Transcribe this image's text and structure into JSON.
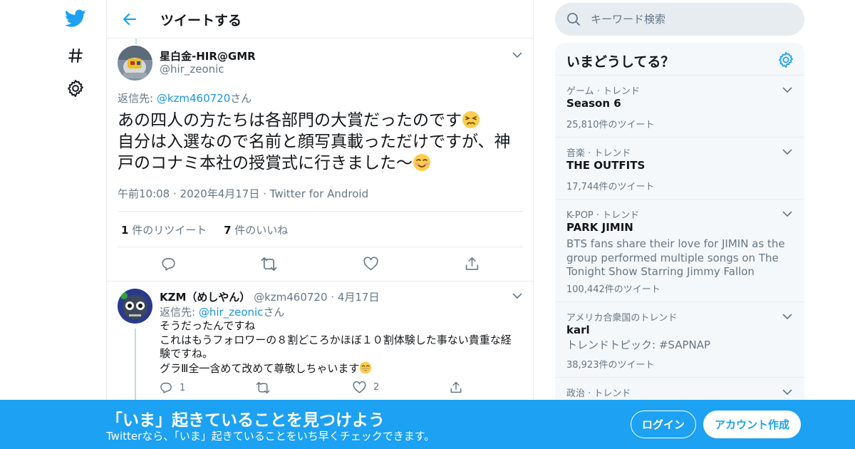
{
  "nav": {
    "logo_icon": "twitter-bird-icon",
    "explore_icon": "hashtag-icon",
    "settings_icon": "gear-icon",
    "accent": "#1da1f2"
  },
  "header": {
    "back_icon": "back-arrow-icon",
    "title": "ツイートする"
  },
  "tweet": {
    "author_name": "星白金-HIR@GMR",
    "author_handle": "@hir_zeonic",
    "reply_to_prefix": "返信先: ",
    "reply_to_handle": "@kzm460720",
    "reply_to_suffix": "さん",
    "text_line1": "あの四人の方たちは各部門の大賞だったのです",
    "text_line2": "自分は入選なので名前と顔写真載っただけですが、神戸のコナミ本社の授賞式に行きました～",
    "emoji1": "persevering-face-emoji",
    "emoji2": "smiling-face-emoji",
    "time": "午前10:08",
    "date": "2020年4月17日",
    "source": "Twitter for Android",
    "retweets_count": "1",
    "retweets_label": "件のリツイート",
    "likes_count": "7",
    "likes_label": "件のいいね",
    "actions": [
      "reply-icon",
      "retweet-icon",
      "like-icon",
      "share-icon"
    ]
  },
  "reply": {
    "author_name": "KZM（めしやん）",
    "author_handle": "@kzm460720",
    "date": "4月17日",
    "reply_to_prefix": "返信先: ",
    "reply_to_handle": "@hir_zeonic",
    "reply_to_suffix": "さん",
    "line1": "そうだったんですね",
    "line2": "これはもうフォロワーの８割どころかほぼ１０割体験した事ない貴重な経験ですね。",
    "line3": "グラⅢ全一含めて改めて尊敬しちゃいます",
    "emoji": "grinning-face-emoji",
    "reply_count": "1",
    "retweet_count": "",
    "like_count": "2"
  },
  "search": {
    "placeholder": "キーワード検索"
  },
  "trends": {
    "title": "いまどうしてる？",
    "items": [
      {
        "category": "ゲーム · トレンド",
        "name": "Season 6",
        "description": "",
        "count": "25,810件のツイート"
      },
      {
        "category": "音楽 · トレンド",
        "name": "THE OUTFITS",
        "description": "",
        "count": "17,744件のツイート"
      },
      {
        "category": "K-POP · トレンド",
        "name": "PARK JIMIN",
        "description": "BTS fans share their love for JIMIN as the group performed multiple songs on The Tonight Show Starring Jimmy Fallon",
        "count": "100,442件のツイート"
      },
      {
        "category": "アメリカ合衆国のトレンド",
        "name": "karl",
        "description": "トレンドトピック: #SAPNAP",
        "count": "38,923件のツイート"
      },
      {
        "category": "政治 · トレンド",
        "name": "",
        "description": "",
        "count": ""
      }
    ]
  },
  "banner": {
    "title": "「いま」起きていることを見つけよう",
    "subtitle": "Twitterなら、「いま」起きていることをいち早くチェックできます。",
    "login_label": "ログイン",
    "signup_label": "アカウント作成"
  }
}
